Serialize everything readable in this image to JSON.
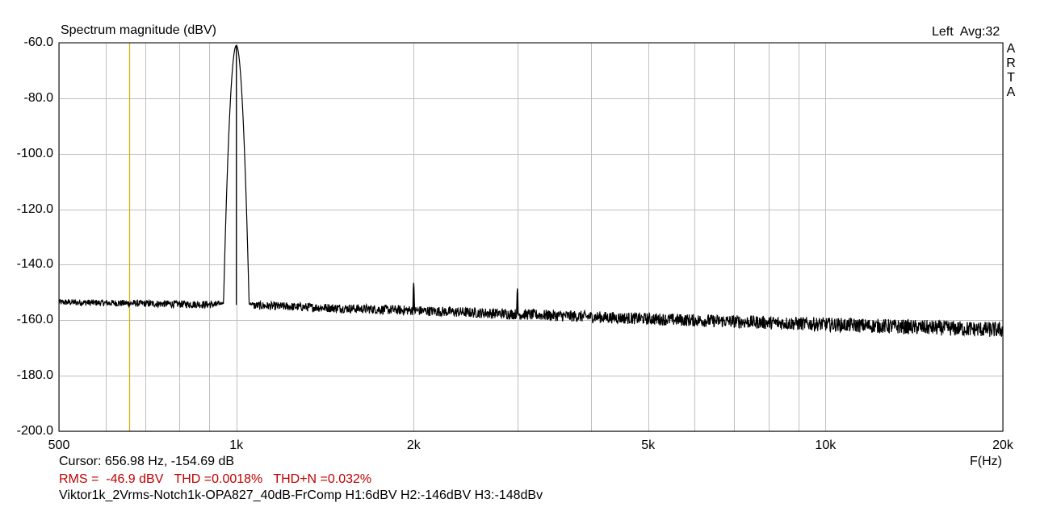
{
  "chart_data": {
    "type": "line",
    "title": "Spectrum magnitude (dBV)",
    "channel_info": "Left  Avg:32",
    "brand_letters": [
      "A",
      "R",
      "T",
      "A"
    ],
    "xlabel": "F(Hz)",
    "x_scale": "log",
    "xlim": [
      500,
      20000
    ],
    "ylim": [
      -200,
      -60
    ],
    "y_ticks": [
      -60,
      -80,
      -100,
      -120,
      -140,
      -160,
      -180,
      -200
    ],
    "y_tick_labels": [
      "-60.0",
      "-80.0",
      "-100.0",
      "-120.0",
      "-140.0",
      "-160.0",
      "-180.0",
      "-200.0"
    ],
    "x_ticks": [
      500,
      1000,
      2000,
      5000,
      10000,
      20000
    ],
    "x_tick_labels": [
      "500",
      "1k",
      "2k",
      "5k",
      "10k",
      "20k"
    ],
    "x_minor_gridlines": [
      600,
      700,
      800,
      900,
      3000,
      4000,
      6000,
      7000,
      8000,
      9000
    ],
    "grid": true,
    "cursor": {
      "frequency_hz": 656.98,
      "level_db": -154.69,
      "color": "#d4b000"
    },
    "series": [
      {
        "color": "#000000",
        "noise_floor": {
          "x": [
            500,
            1000,
            2000,
            5000,
            10000,
            20000
          ],
          "y": [
            -153.5,
            -154.5,
            -156.5,
            -159.5,
            -161.5,
            -163.5
          ]
        },
        "peaks": [
          {
            "x": 1000,
            "y": -61
          },
          {
            "x": 2000,
            "y": -146.5
          },
          {
            "x": 3000,
            "y": -148.5
          }
        ]
      }
    ]
  },
  "readouts": {
    "cursor_line": "Cursor: 656.98 Hz, -154.69 dB",
    "rms_line": "RMS =  -46.9 dBV   THD =0.0018%   THD+N =0.032%",
    "description_line": "Viktor1k_2Vrms-Notch1k-OPA827_40dB-FrComp H1:6dBV H2:-146dBV H3:-148dBv"
  },
  "colors": {
    "grid": "#c0c0c0",
    "frame": "#000000",
    "stats_text": "#c00000",
    "trace": "#000000"
  }
}
